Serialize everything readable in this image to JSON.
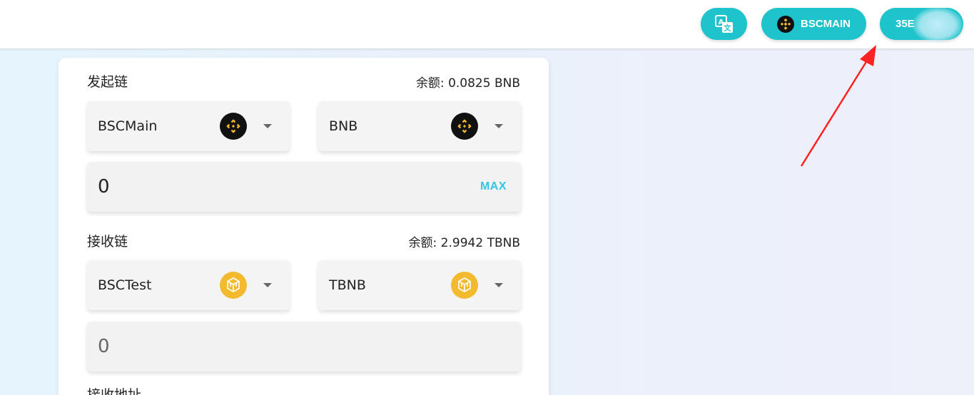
{
  "header": {
    "network_label": "BSCMAIN",
    "account_label": "35E"
  },
  "send": {
    "label": "发起链",
    "balance": "余额: 0.0825 BNB",
    "chain": "BSCMain",
    "token": "BNB",
    "amount": "0",
    "max_label": "MAX"
  },
  "receive": {
    "label": "接收链",
    "balance": "余额: 2.9942 TBNB",
    "chain": "BSCTest",
    "token": "TBNB",
    "amount": "0"
  },
  "address": {
    "label": "接收地址"
  },
  "colors": {
    "accent": "#1ec3cc",
    "max": "#33c6e0",
    "bnb_gold": "#f3ba2f",
    "annotation_arrow": "#ff2222"
  },
  "icons": [
    "translate-icon",
    "bnb-logo-icon",
    "tbnb-logo-icon",
    "chevron-down-icon"
  ]
}
